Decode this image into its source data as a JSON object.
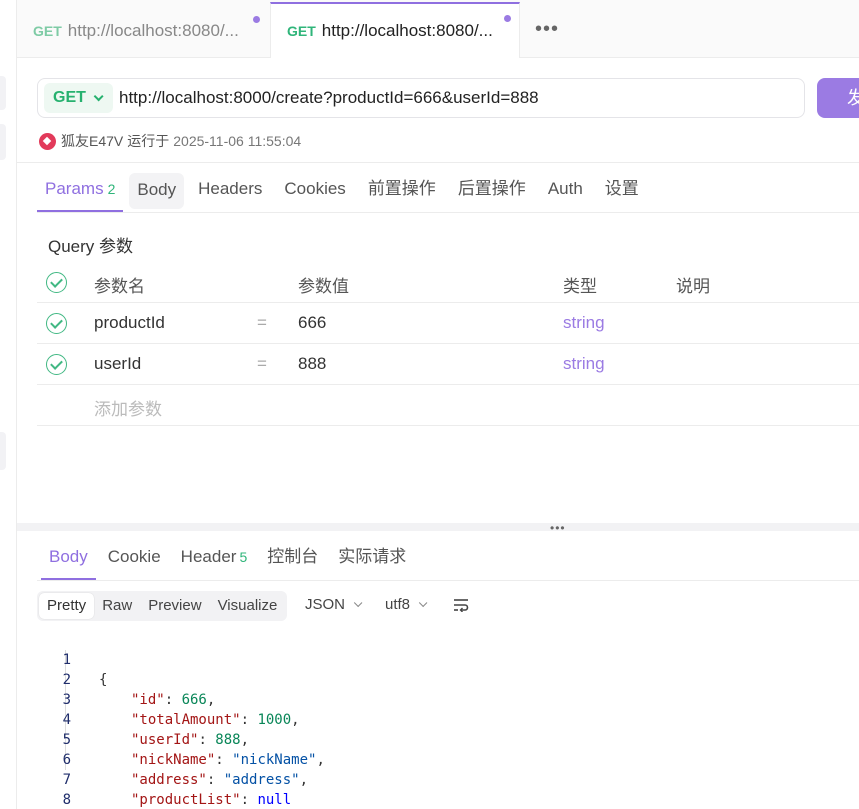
{
  "tabs": [
    {
      "method": "GET",
      "label": "http://localhost:8080/..."
    },
    {
      "method": "GET",
      "label": "http://localhost:8080/..."
    }
  ],
  "tab_more": "•••",
  "request": {
    "method": "GET",
    "url": "http://localhost:8000/create?productId=666&userId=888",
    "send_label": "发"
  },
  "run_info": {
    "user": "狐友E47V",
    "ran_label": "运行于",
    "timestamp": "2025-11-06 11:55:04"
  },
  "request_tabs": [
    {
      "label": "Params",
      "badge": "2"
    },
    {
      "label": "Body"
    },
    {
      "label": "Headers"
    },
    {
      "label": "Cookies"
    },
    {
      "label": "前置操作"
    },
    {
      "label": "后置操作"
    },
    {
      "label": "Auth"
    },
    {
      "label": "设置"
    }
  ],
  "query": {
    "title": "Query 参数",
    "headers": {
      "name": "参数名",
      "value": "参数值",
      "type": "类型",
      "desc": "说明"
    },
    "rows": [
      {
        "name": "productId",
        "eq": "=",
        "value": "666",
        "type": "string"
      },
      {
        "name": "userId",
        "eq": "=",
        "value": "888",
        "type": "string"
      }
    ],
    "add_placeholder": "添加参数"
  },
  "splitter_handle": "•••",
  "response_tabs": [
    {
      "label": "Body"
    },
    {
      "label": "Cookie"
    },
    {
      "label": "Header",
      "badge": "5"
    },
    {
      "label": "控制台"
    },
    {
      "label": "实际请求"
    }
  ],
  "format": {
    "modes": [
      "Pretty",
      "Raw",
      "Preview",
      "Visualize"
    ],
    "type": "JSON",
    "encoding": "utf8"
  },
  "code": {
    "line_numbers": [
      "1",
      "2",
      "3",
      "4",
      "5",
      "6",
      "7",
      "8"
    ],
    "open": "{",
    "close": "}",
    "fields": [
      {
        "key": "\"id\"",
        "value": "666",
        "comma": ","
      },
      {
        "key": "\"totalAmount\"",
        "value": "1000",
        "comma": ","
      },
      {
        "key": "\"userId\"",
        "value": "888",
        "comma": ","
      },
      {
        "key": "\"nickName\"",
        "value": "\"nickName\"",
        "comma": ","
      },
      {
        "key": "\"address\"",
        "value": "\"address\"",
        "comma": ","
      },
      {
        "key": "\"productList\"",
        "value": "null",
        "comma": ""
      }
    ]
  },
  "colors": {
    "accent": "#8f6fe0",
    "get_method": "#27b16f",
    "badge": "#2fb57a"
  }
}
